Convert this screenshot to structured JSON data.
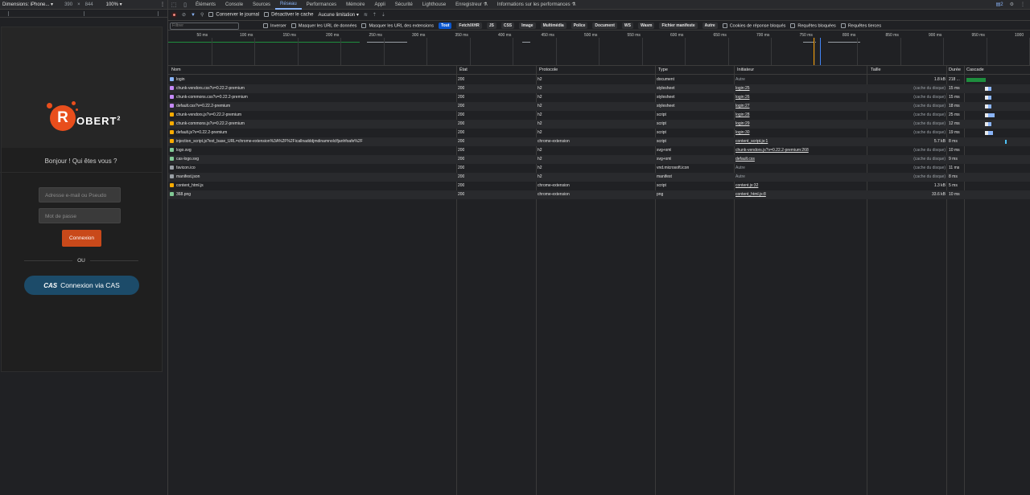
{
  "device_toolbar": {
    "dimensions_label": "Dimensions: iPhone...",
    "width": "390",
    "times": "×",
    "height": "844",
    "zoom": "100%",
    "more": "⋮"
  },
  "login_page": {
    "logo_text": "OBERT",
    "logo_letter": "R",
    "logo_sup": "2",
    "greeting": "Bonjour ! Qui êtes vous ?",
    "email_placeholder": "Adresse e-mail ou Pseudo",
    "password_placeholder": "Mot de passe",
    "login_button": "Connexion",
    "or_label": "OU",
    "cas_icon": "CAS",
    "cas_button": "Connexion via CAS"
  },
  "devtools": {
    "tabs": [
      "Éléments",
      "Console",
      "Sources",
      "Réseau",
      "Performances",
      "Mémoire",
      "Appli",
      "Sécurité",
      "Lighthouse",
      "Enregistreur ⚗",
      "Informations sur les performances ⚗"
    ],
    "active_tab": 3,
    "issues_badge": "2",
    "toolbar": {
      "preserve_log": "Conserver le journal",
      "disable_cache": "Désactiver le cache",
      "throttle": "Aucune limitation"
    },
    "filter": {
      "placeholder": "Filtrer",
      "invert": "Inverser",
      "hide_data": "Masquer les URL de données",
      "hide_ext": "Masquer les URL des extensions",
      "types": [
        "Tout",
        "Fetch/XHR",
        "JS",
        "CSS",
        "Image",
        "Multimédia",
        "Police",
        "Document",
        "WS",
        "Wasm",
        "Fichier manifeste",
        "Autre"
      ],
      "blocked_cookies": "Cookies de réponse bloqués",
      "blocked_requests": "Requêtes bloquées",
      "third_party": "Requêtes tierces"
    },
    "timeline_labels": [
      "50 ms",
      "100 ms",
      "150 ms",
      "200 ms",
      "250 ms",
      "300 ms",
      "350 ms",
      "400 ms",
      "450 ms",
      "500 ms",
      "550 ms",
      "600 ms",
      "650 ms",
      "700 ms",
      "750 ms",
      "800 ms",
      "850 ms",
      "900 ms",
      "950 ms",
      "1000"
    ],
    "columns": {
      "name": "Nom",
      "status": "État",
      "protocol": "Protocole",
      "type": "Type",
      "initiator": "Initiateur",
      "size": "Taille",
      "time": "Durée",
      "waterfall": "Cascade"
    },
    "requests": [
      {
        "name": "login",
        "status": "200",
        "protocol": "h2",
        "type": "document",
        "initiator": "Autre",
        "size": "1.8 kB",
        "time": "218 ...",
        "icon": "document-icon",
        "link": false
      },
      {
        "name": "chunk-vendors.css?v=0.22.2-premium",
        "status": "200",
        "protocol": "h2",
        "type": "stylesheet",
        "initiator": "login:25",
        "size": "(cache du disque)",
        "time": "15 ms",
        "icon": "stylesheet-icon",
        "link": true
      },
      {
        "name": "chunk-commons.css?v=0.22.2-premium",
        "status": "200",
        "protocol": "h2",
        "type": "stylesheet",
        "initiator": "login:26",
        "size": "(cache du disque)",
        "time": "15 ms",
        "icon": "stylesheet-icon",
        "link": true
      },
      {
        "name": "default.css?v=0.22.2-premium",
        "status": "200",
        "protocol": "h2",
        "type": "stylesheet",
        "initiator": "login:27",
        "size": "(cache du disque)",
        "time": "18 ms",
        "icon": "stylesheet-icon",
        "link": true
      },
      {
        "name": "chunk-vendors.js?v=0.22.2-premium",
        "status": "200",
        "protocol": "h2",
        "type": "script",
        "initiator": "login:28",
        "size": "(cache du disque)",
        "time": "25 ms",
        "icon": "script-icon",
        "link": true
      },
      {
        "name": "chunk-commons.js?v=0.22.2-premium",
        "status": "200",
        "protocol": "h2",
        "type": "script",
        "initiator": "login:29",
        "size": "(cache du disque)",
        "time": "12 ms",
        "icon": "script-icon",
        "link": true
      },
      {
        "name": "default.js?v=0.22.2-premium",
        "status": "200",
        "protocol": "h2",
        "type": "script",
        "initiator": "login:30",
        "size": "(cache du disque)",
        "time": "19 ms",
        "icon": "script-icon",
        "link": true
      },
      {
        "name": "injection_script.js?ext_base_URL=chrome-extension%3A%2F%2Ficallnadddjmdinamnolclfjanhfoafe%2F",
        "status": "200",
        "protocol": "chrome-extension",
        "type": "script",
        "initiator": "content_script.js:1",
        "size": "5.7 kB",
        "time": "8 ms",
        "icon": "script-icon",
        "link": true
      },
      {
        "name": "logo.svg",
        "status": "200",
        "protocol": "h2",
        "type": "svg+xml",
        "initiator": "chunk-vendors.js?v=0.22.2-premium:268",
        "size": "(cache du disque)",
        "time": "10 ms",
        "icon": "image-icon",
        "link": true
      },
      {
        "name": "cas-logo.svg",
        "status": "200",
        "protocol": "h2",
        "type": "svg+xml",
        "initiator": "default.css",
        "size": "(cache du disque)",
        "time": "9 ms",
        "icon": "image-icon",
        "link": true
      },
      {
        "name": "favicon.ico",
        "status": "200",
        "protocol": "h2",
        "type": "vnd.microsoft.icon",
        "initiator": "Autre",
        "size": "(cache du disque)",
        "time": "11 ms",
        "icon": "other-icon",
        "link": false
      },
      {
        "name": "manifest.json",
        "status": "200",
        "protocol": "h2",
        "type": "manifest",
        "initiator": "Autre",
        "size": "(cache du disque)",
        "time": "8 ms",
        "icon": "other-icon",
        "link": false
      },
      {
        "name": "content_html.js",
        "status": "200",
        "protocol": "chrome-extension",
        "type": "script",
        "initiator": "content.js:32",
        "size": "1.3 kB",
        "time": "5 ms",
        "icon": "script-icon",
        "link": true
      },
      {
        "name": "368.png",
        "status": "200",
        "protocol": "chrome-extension",
        "type": "png",
        "initiator": "content_html.js:8",
        "size": "33.6 kB",
        "time": "10 ms",
        "icon": "image-icon",
        "link": true
      }
    ]
  }
}
